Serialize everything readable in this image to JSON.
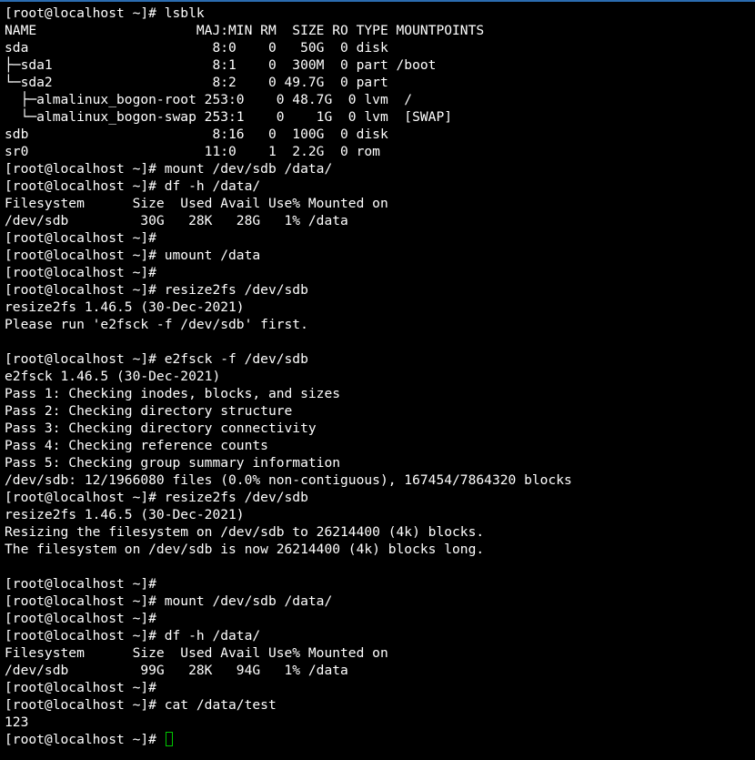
{
  "colors": {
    "background": "#000000",
    "foreground": "#ffffff",
    "cursor": "#00c800",
    "window_border": "#2b6cb0"
  },
  "terminal": {
    "lines": [
      "[root@localhost ~]# lsblk",
      "NAME                    MAJ:MIN RM  SIZE RO TYPE MOUNTPOINTS",
      "sda                       8:0    0   50G  0 disk",
      "├─sda1                    8:1    0  300M  0 part /boot",
      "└─sda2                    8:2    0 49.7G  0 part",
      "  ├─almalinux_bogon-root 253:0    0 48.7G  0 lvm  /",
      "  └─almalinux_bogon-swap 253:1    0    1G  0 lvm  [SWAP]",
      "sdb                       8:16   0  100G  0 disk",
      "sr0                      11:0    1  2.2G  0 rom",
      "[root@localhost ~]# mount /dev/sdb /data/",
      "[root@localhost ~]# df -h /data/",
      "Filesystem      Size  Used Avail Use% Mounted on",
      "/dev/sdb         30G   28K   28G   1% /data",
      "[root@localhost ~]#",
      "[root@localhost ~]# umount /data",
      "[root@localhost ~]#",
      "[root@localhost ~]# resize2fs /dev/sdb",
      "resize2fs 1.46.5 (30-Dec-2021)",
      "Please run 'e2fsck -f /dev/sdb' first.",
      "",
      "[root@localhost ~]# e2fsck -f /dev/sdb",
      "e2fsck 1.46.5 (30-Dec-2021)",
      "Pass 1: Checking inodes, blocks, and sizes",
      "Pass 2: Checking directory structure",
      "Pass 3: Checking directory connectivity",
      "Pass 4: Checking reference counts",
      "Pass 5: Checking group summary information",
      "/dev/sdb: 12/1966080 files (0.0% non-contiguous), 167454/7864320 blocks",
      "[root@localhost ~]# resize2fs /dev/sdb",
      "resize2fs 1.46.5 (30-Dec-2021)",
      "Resizing the filesystem on /dev/sdb to 26214400 (4k) blocks.",
      "The filesystem on /dev/sdb is now 26214400 (4k) blocks long.",
      "",
      "[root@localhost ~]#",
      "[root@localhost ~]# mount /dev/sdb /data/",
      "[root@localhost ~]#",
      "[root@localhost ~]# df -h /data/",
      "Filesystem      Size  Used Avail Use% Mounted on",
      "/dev/sdb         99G   28K   94G   1% /data",
      "[root@localhost ~]#",
      "[root@localhost ~]# cat /data/test",
      "123"
    ],
    "prompt": "[root@localhost ~]# "
  }
}
